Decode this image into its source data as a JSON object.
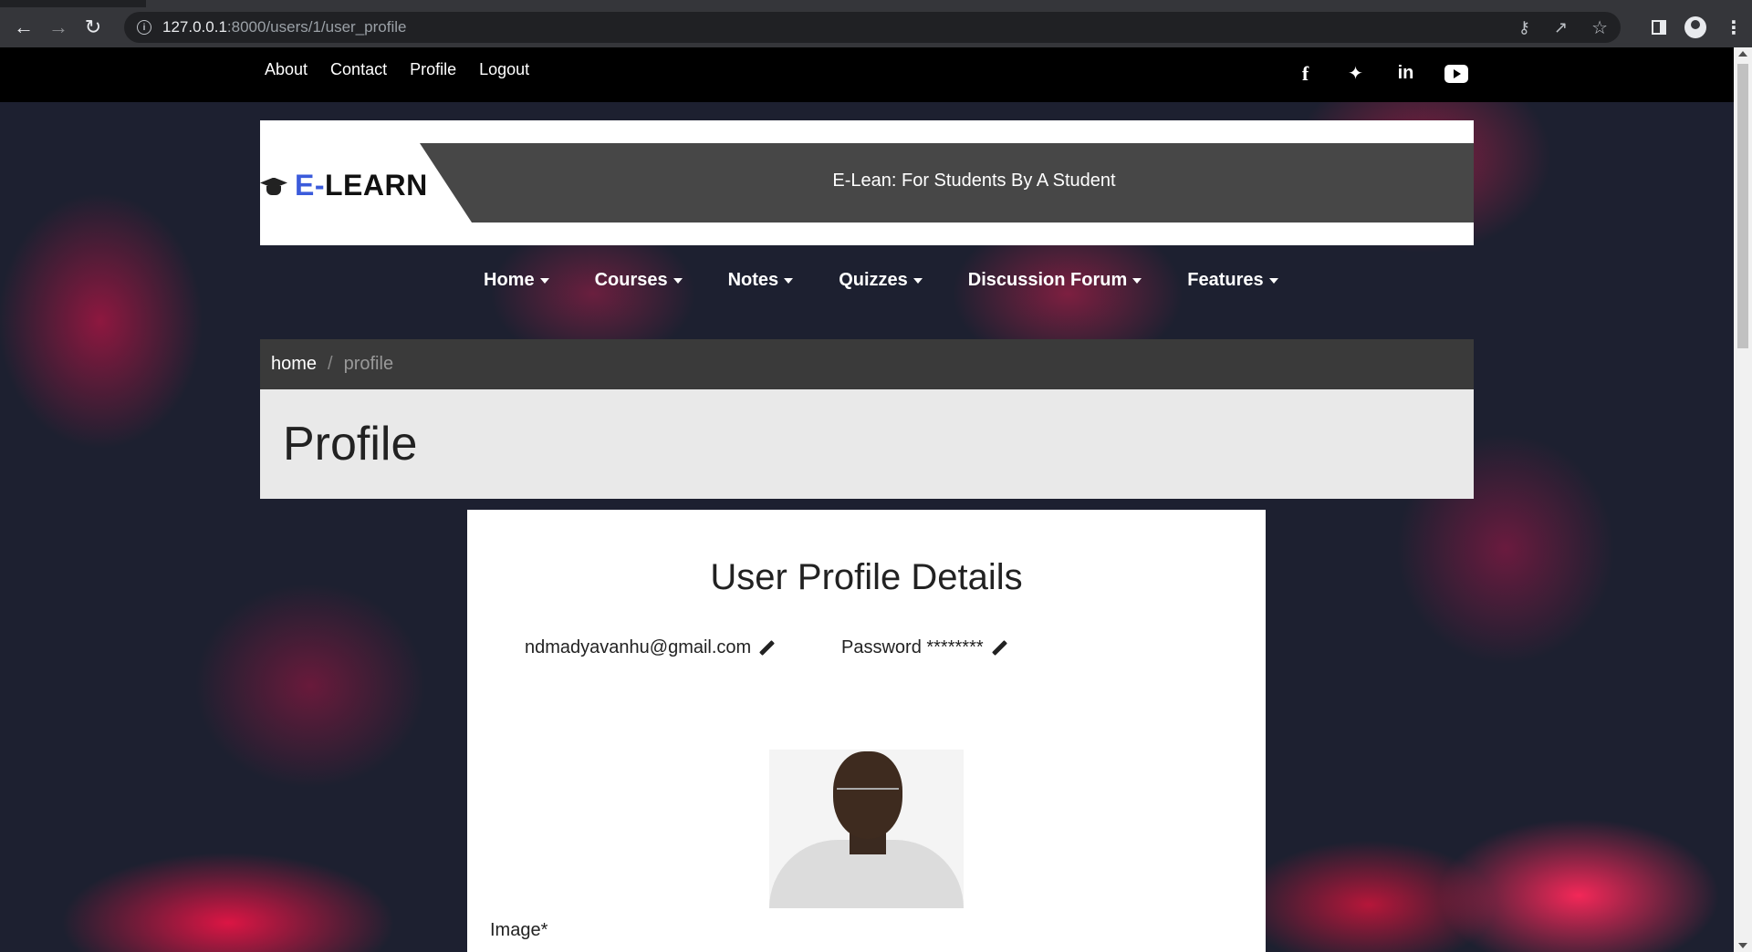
{
  "browser": {
    "url_host": "127.0.0.1",
    "url_path": ":8000/users/1/user_profile"
  },
  "topnav": [
    "About",
    "Contact",
    "Profile",
    "Logout"
  ],
  "social": [
    "facebook-icon",
    "twitter-icon",
    "linkedin-icon",
    "youtube-icon"
  ],
  "brand": {
    "logo_prefix": "E-",
    "logo_main": "LEARN",
    "tagline": "E-Lean: For Students By A Student"
  },
  "mainnav": [
    "Home",
    "Courses",
    "Notes",
    "Quizzes",
    "Discussion Forum",
    "Features"
  ],
  "breadcrumb": {
    "home": "home",
    "separator": "/",
    "current": "profile"
  },
  "page_title": "Profile",
  "card": {
    "heading": "User Profile Details",
    "email": "ndmadyavanhu@gmail.com",
    "password_label": "Password ********",
    "image_label": "Image*"
  }
}
